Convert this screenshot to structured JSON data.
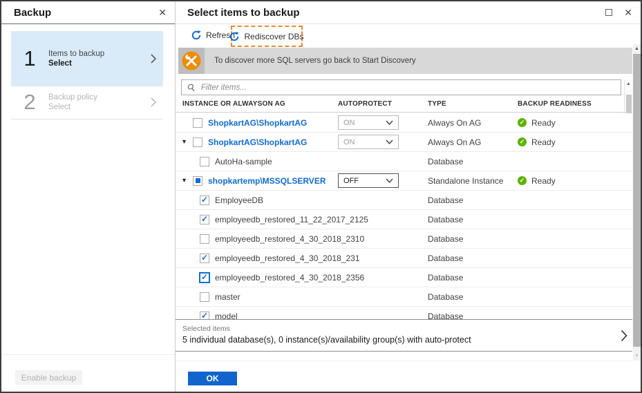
{
  "colors": {
    "accent_blue": "#0f6cd6",
    "ok_button": "#1164cd",
    "step_active_bg": "#d9eaf8",
    "banner_bg": "#d8d8d8",
    "banner_icon_bg": "#bdbdbd",
    "banner_icon_circle": "#ef8c00",
    "annotation_orange": "#ee8728",
    "ready_green": "#5db300"
  },
  "icons": {
    "close": "✕",
    "maximize": "window-outline-square",
    "refresh": "blue-circular-arrow",
    "tools": "wrench-and-screwdriver-in-orange-circle",
    "search": "magnifier",
    "expander_down": "▾",
    "check": "✓",
    "scroll_up": "▲",
    "scroll_down": "▼",
    "chevron_right": "›"
  },
  "left_panel": {
    "title": "Backup",
    "steps": [
      {
        "number": "1",
        "label": "Items to backup",
        "sublabel": "Select",
        "active": true
      },
      {
        "number": "2",
        "label": "Backup policy",
        "sublabel": "Select",
        "active": false
      }
    ],
    "enable_backup_label": "Enable backup"
  },
  "main_panel": {
    "title": "Select items to backup",
    "toolbar": {
      "refresh_label": "Refresh",
      "rediscover_label": "Rediscover DBs"
    },
    "banner": {
      "text": "To discover more SQL servers go back to Start Discovery"
    },
    "filter": {
      "placeholder": "Filter items..."
    },
    "table": {
      "columns": [
        "INSTANCE OR ALWAYSON AG",
        "AUTOPROTECT",
        "TYPE",
        "BACKUP READINESS"
      ],
      "rows": [
        {
          "name": "ShopkartAG\\ShopkartAG",
          "kind": "instance",
          "expander": false,
          "check": "unchecked",
          "focused": false,
          "autoprotect": "ON",
          "autoprotect_enabled": false,
          "type": "Always On AG",
          "readiness": "Ready"
        },
        {
          "name": "ShopkartAG\\ShopkartAG",
          "kind": "instance",
          "expander": true,
          "check": "unchecked",
          "focused": false,
          "autoprotect": "ON",
          "autoprotect_enabled": false,
          "type": "Always On AG",
          "readiness": "Ready"
        },
        {
          "name": "AutoHa-sample",
          "kind": "database",
          "expander": false,
          "check": "unchecked",
          "focused": false,
          "autoprotect": null,
          "autoprotect_enabled": false,
          "type": "Database",
          "readiness": null
        },
        {
          "name": "shopkartemp\\MSSQLSERVER",
          "kind": "instance",
          "expander": true,
          "check": "indeterminate",
          "focused": false,
          "autoprotect": "OFF",
          "autoprotect_enabled": true,
          "type": "Standalone Instance",
          "readiness": "Ready"
        },
        {
          "name": "EmployeeDB",
          "kind": "database",
          "expander": false,
          "check": "checked",
          "focused": false,
          "autoprotect": null,
          "autoprotect_enabled": false,
          "type": "Database",
          "readiness": null
        },
        {
          "name": "employeedb_restored_11_22_2017_2125",
          "kind": "database",
          "expander": false,
          "check": "checked",
          "focused": false,
          "autoprotect": null,
          "autoprotect_enabled": false,
          "type": "Database",
          "readiness": null
        },
        {
          "name": "employeedb_restored_4_30_2018_2310",
          "kind": "database",
          "expander": false,
          "check": "unchecked",
          "focused": false,
          "autoprotect": null,
          "autoprotect_enabled": false,
          "type": "Database",
          "readiness": null
        },
        {
          "name": "employeedb_restored_4_30_2018_231",
          "kind": "database",
          "expander": false,
          "check": "checked",
          "focused": false,
          "autoprotect": null,
          "autoprotect_enabled": false,
          "type": "Database",
          "readiness": null
        },
        {
          "name": "employeedb_restored_4_30_2018_2356",
          "kind": "database",
          "expander": false,
          "check": "checked",
          "focused": true,
          "autoprotect": null,
          "autoprotect_enabled": false,
          "type": "Database",
          "readiness": null
        },
        {
          "name": "master",
          "kind": "database",
          "expander": false,
          "check": "unchecked",
          "focused": false,
          "autoprotect": null,
          "autoprotect_enabled": false,
          "type": "Database",
          "readiness": null
        },
        {
          "name": "model",
          "kind": "database",
          "expander": false,
          "check": "checked",
          "focused": false,
          "autoprotect": null,
          "autoprotect_enabled": false,
          "type": "Database",
          "readiness": null
        }
      ]
    },
    "footer": {
      "label": "Selected items",
      "summary": "5 individual database(s), 0 instance(s)/availability group(s) with auto-protect"
    },
    "ok_label": "OK"
  }
}
